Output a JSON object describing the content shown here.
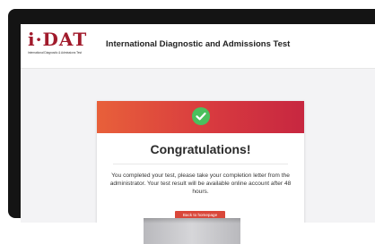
{
  "header": {
    "logo_main": "i·DAT",
    "logo_tagline": "International Diagnostic & Admissions Test",
    "title": "International Diagnostic and Admissions Test"
  },
  "card": {
    "title": "Congratulations!",
    "message": "You completed your test, please take your completion letter from the administrator. Your test result will be available online account after 48 hours.",
    "button_label": "Back to homepage"
  },
  "colors": {
    "brand": "#a11a2b",
    "banner_start": "#e8603a",
    "banner_end": "#c72740",
    "success": "#4bbf5d",
    "button": "#d9473a"
  },
  "icons": {
    "status": "check-circle-icon"
  }
}
